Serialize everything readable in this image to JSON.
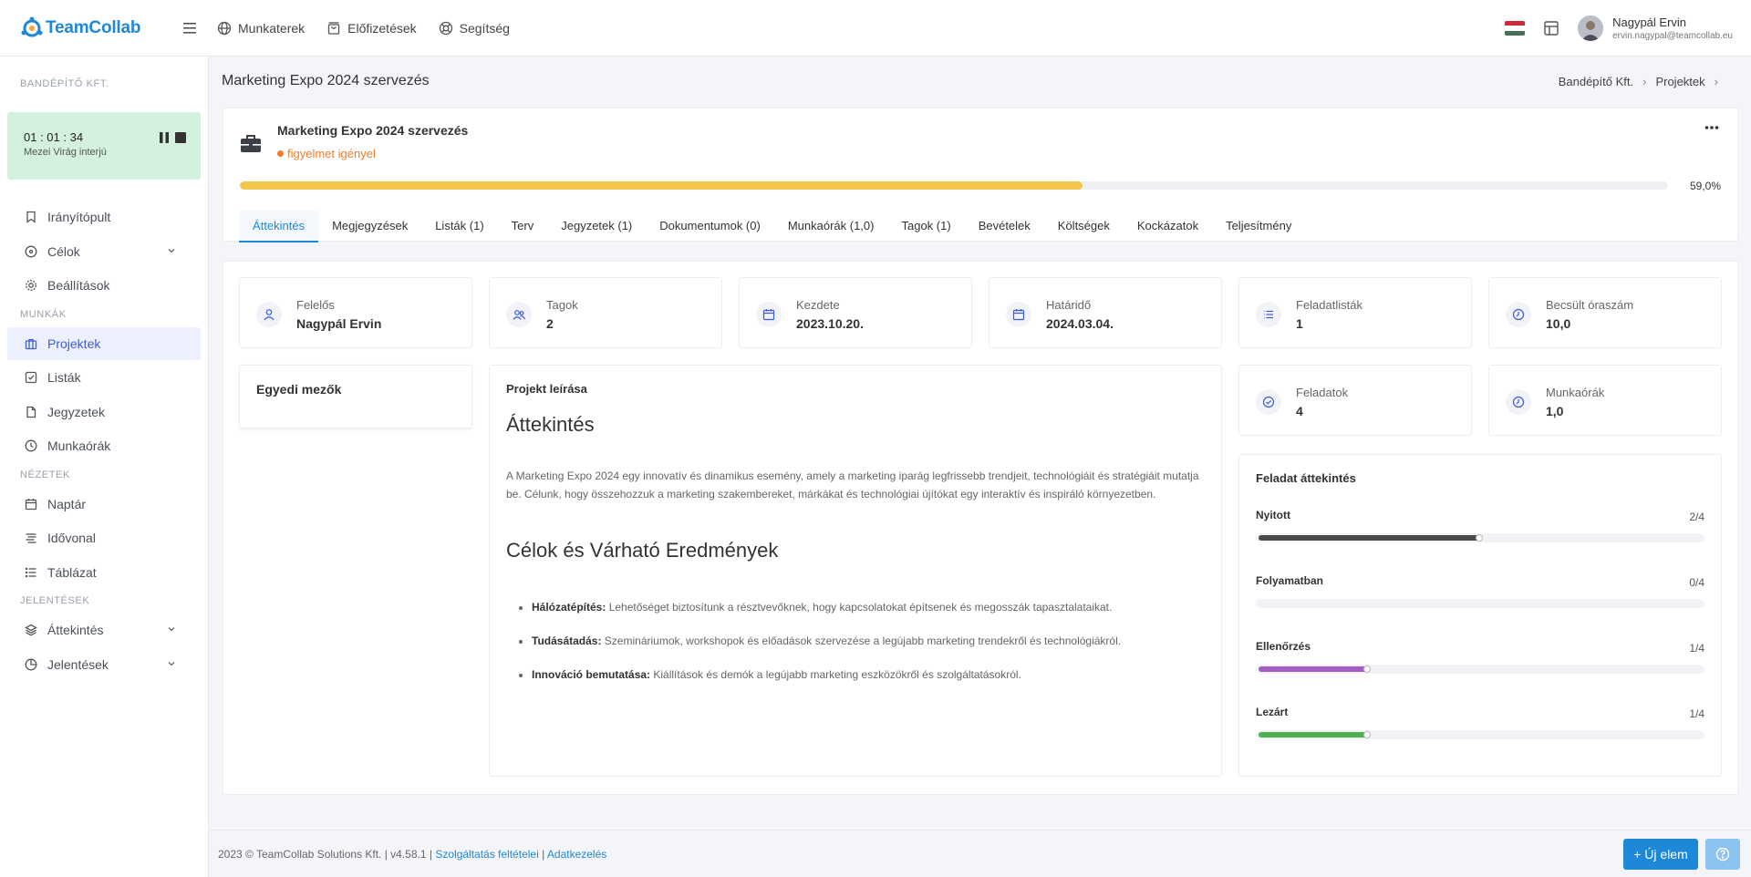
{
  "app": {
    "name": "TeamCollab"
  },
  "topnav": [
    {
      "label": "Munkaterek",
      "icon": "globe-icon"
    },
    {
      "label": "Előfizetések",
      "icon": "shopping-bag-icon"
    },
    {
      "label": "Segítség",
      "icon": "lifebuoy-icon"
    }
  ],
  "user": {
    "name": "Nagypál Ervin",
    "email": "ervin.nagypal@teamcollab.eu"
  },
  "sidebar": {
    "org": "BANDÉPÍTŐ KFT.",
    "timer": {
      "time": "01 : 01 : 34",
      "label": "Mezei Virág interjú"
    },
    "items_top": [
      {
        "label": "Irányítópult",
        "icon": "bookmark-icon"
      },
      {
        "label": "Célok",
        "icon": "compass-icon"
      },
      {
        "label": "Beállítások",
        "icon": "gear-icon"
      }
    ],
    "section_work": "MUNKÁK",
    "items_work": [
      {
        "label": "Projektek",
        "icon": "briefcase-icon"
      },
      {
        "label": "Listák",
        "icon": "checkbox-icon"
      },
      {
        "label": "Jegyzetek",
        "icon": "file-icon"
      },
      {
        "label": "Munkaórák",
        "icon": "clock-icon"
      }
    ],
    "section_views": "NÉZETEK",
    "items_views": [
      {
        "label": "Naptár",
        "icon": "calendar-icon"
      },
      {
        "label": "Idővonal",
        "icon": "timeline-icon"
      },
      {
        "label": "Táblázat",
        "icon": "list-icon"
      }
    ],
    "section_reports": "JELENTÉSEK",
    "items_reports": [
      {
        "label": "Áttekintés",
        "icon": "layers-icon"
      },
      {
        "label": "Jelentések",
        "icon": "pie-chart-icon"
      }
    ]
  },
  "page": {
    "title": "Marketing Expo 2024 szervezés",
    "breadcrumb": [
      "Bandépítő Kft.",
      "Projektek"
    ]
  },
  "project": {
    "name": "Marketing Expo 2024 szervezés",
    "status": "figyelmet igényel",
    "status_color": "#f07b2b",
    "progress": 0.59,
    "progress_label": "59,0%",
    "progress_color": "#f3c64c",
    "tabs": [
      "Áttekintés",
      "Megjegyzések",
      "Listák (1)",
      "Terv",
      "Jegyzetek (1)",
      "Dokumentumok (0)",
      "Munkaórák (1,0)",
      "Tagok (1)",
      "Bevételek",
      "Költségek",
      "Kockázatok",
      "Teljesítmény"
    ],
    "active_tab": 0
  },
  "stats": [
    {
      "label": "Felelős",
      "value": "Nagypál Ervin",
      "icon": "user-icon"
    },
    {
      "label": "Tagok",
      "value": "2",
      "icon": "users-icon"
    },
    {
      "label": "Kezdete",
      "value": "2023.10.20.",
      "icon": "calendar-icon"
    },
    {
      "label": "Határidő",
      "value": "2024.03.04.",
      "icon": "calendar-icon"
    },
    {
      "label": "Feladatlisták",
      "value": "1",
      "icon": "list-icon"
    },
    {
      "label": "Becsült óraszám",
      "value": "10,0",
      "icon": "clock-icon"
    },
    {
      "label": "Feladatok",
      "value": "4",
      "icon": "check-circle-icon"
    },
    {
      "label": "Munkaórák",
      "value": "1,0",
      "icon": "clock-icon"
    }
  ],
  "custom_fields": {
    "title": "Egyedi mezők"
  },
  "description": {
    "title": "Projekt leírása",
    "h1": "Áttekintés",
    "paragraph": "A Marketing Expo 2024 egy innovatív és dinamikus esemény, amely a marketing iparág legfrissebb trendjeit, technológiáit és stratégiáit mutatja be. Célunk, hogy összehozzuk a marketing szakembereket, márkákat és technológiai újítókat egy interaktív és inspiráló környezetben.",
    "h2": "Célok és Várható Eredmények",
    "bullets": [
      {
        "bold": "Hálózatépítés:",
        "text": " Lehetőséget biztosítunk a résztvevőknek, hogy kapcsolatokat építsenek és megosszák tapasztalataikat."
      },
      {
        "bold": "Tudásátadás:",
        "text": " Szemináriumok, workshopok és előadások szervezése a legújabb marketing trendekről és technológiákról."
      },
      {
        "bold": "Innováció bemutatása:",
        "text": " Kiállítások és demók a legújabb marketing eszközökről és szolgáltatásokról."
      }
    ]
  },
  "task_overview": {
    "title": "Feladat áttekintés",
    "rows": [
      {
        "label": "Nyitott",
        "count": "2/4",
        "fraction": 0.5,
        "color": "#4a4a4a"
      },
      {
        "label": "Folyamatban",
        "count": "0/4",
        "fraction": 0,
        "color": "#4a4a4a"
      },
      {
        "label": "Ellenőrzés",
        "count": "1/4",
        "fraction": 0.25,
        "color": "#a45dc4"
      },
      {
        "label": "Lezárt",
        "count": "1/4",
        "fraction": 0.25,
        "color": "#4caf50"
      }
    ]
  },
  "footer": {
    "copyright": "2023 © TeamCollab Solutions Kft. | v4.58.1 |",
    "terms": "Szolgáltatás feltételei",
    "sep": "|",
    "privacy": "Adatkezelés",
    "new_button": "+ Új elem"
  },
  "colors": {
    "brand": "#1e88d8",
    "active_nav": "#3b5bdb",
    "timer_bg": "#d4f1dd"
  }
}
